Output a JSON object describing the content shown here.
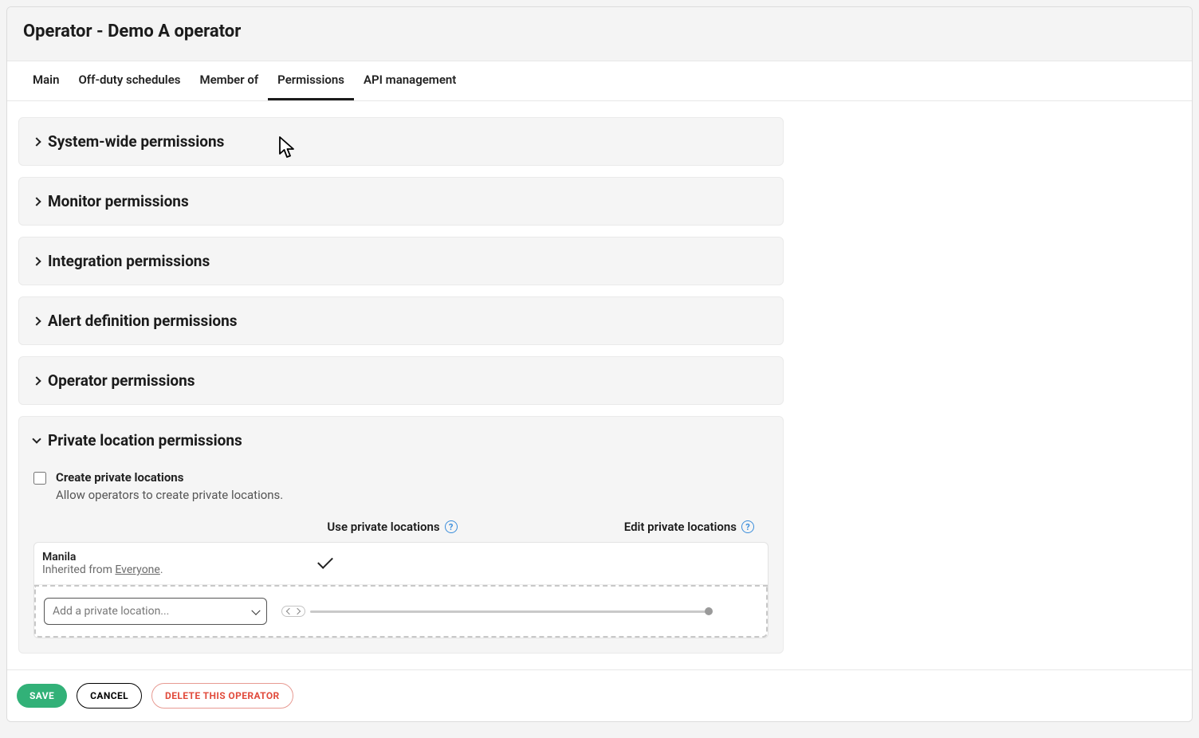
{
  "page_title": "Operator - Demo A operator",
  "tabs": [
    "Main",
    "Off-duty schedules",
    "Member of",
    "Permissions",
    "API management"
  ],
  "active_tab_index": 3,
  "sections": {
    "system_wide": "System-wide permissions",
    "monitor": "Monitor permissions",
    "integration": "Integration permissions",
    "alert_definition": "Alert definition permissions",
    "operator": "Operator permissions",
    "private_location": "Private location permissions"
  },
  "private_location_section": {
    "create_label": "Create private locations",
    "create_desc": "Allow operators to create private locations.",
    "create_checked": false,
    "col_use": "Use private locations",
    "col_edit": "Edit private locations",
    "rows": [
      {
        "name": "Manila",
        "inherited_prefix": "Inherited from ",
        "inherited_from": "Everyone",
        "inherited_suffix": ".",
        "use": true,
        "edit": false
      }
    ],
    "add_placeholder": "Add a private location..."
  },
  "footer": {
    "save": "SAVE",
    "cancel": "CANCEL",
    "delete": "DELETE THIS OPERATOR"
  }
}
